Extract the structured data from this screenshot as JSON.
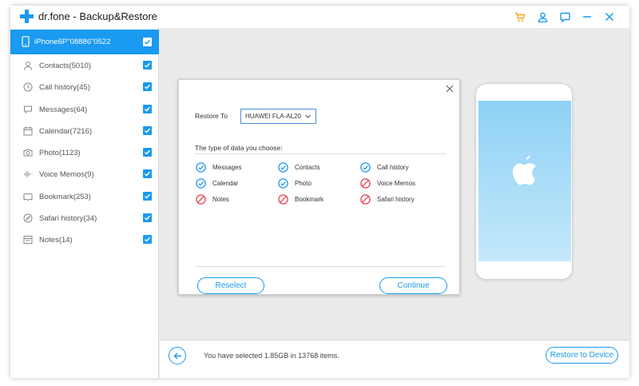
{
  "app": {
    "brand": "dr.fone",
    "title": "- Backup&Restore",
    "window_icons": [
      "cart-icon",
      "account-icon",
      "feedback-icon",
      "minimize-icon",
      "close-icon"
    ]
  },
  "colors": {
    "accent": "#1a9af0",
    "error": "#e8424f",
    "bg": "#ebebeb"
  },
  "sidebar": {
    "device": {
      "name": "iPhone6P\"08886\"0522",
      "checked": true
    },
    "items": [
      {
        "label": "Contacts(5010)",
        "icon": "contacts-icon",
        "checked": true
      },
      {
        "label": "Call history(45)",
        "icon": "clock-icon",
        "checked": true
      },
      {
        "label": "Messages(64)",
        "icon": "chat-icon",
        "checked": true
      },
      {
        "label": "Calendar(7216)",
        "icon": "calendar-icon",
        "checked": true
      },
      {
        "label": "Photo(1123)",
        "icon": "camera-icon",
        "checked": true
      },
      {
        "label": "Voice Memos(9)",
        "icon": "waveform-icon",
        "checked": true
      },
      {
        "label": "Bookmark(253)",
        "icon": "bookmark-icon",
        "checked": true
      },
      {
        "label": "Safari history(34)",
        "icon": "compass-icon",
        "checked": true
      },
      {
        "label": "Notes(14)",
        "icon": "note-icon",
        "checked": true
      }
    ]
  },
  "dialog": {
    "restore_to_label": "Restore To",
    "selected_device": "HUAWEI FLA-AL20",
    "types_title": "The type of data you choose:",
    "types": [
      {
        "label": "Messages",
        "supported": true
      },
      {
        "label": "Contacts",
        "supported": true
      },
      {
        "label": "Call history",
        "supported": true
      },
      {
        "label": "Calendar",
        "supported": true
      },
      {
        "label": "Photo",
        "supported": true
      },
      {
        "label": "Voice Memos",
        "supported": false
      },
      {
        "label": "Notes",
        "supported": false
      },
      {
        "label": "Bookmark",
        "supported": false
      },
      {
        "label": "Safari history",
        "supported": false
      }
    ],
    "reselect_label": "Reselect",
    "continue_label": "Continue"
  },
  "footer": {
    "status_text": "You have selected 1.85GB in 13768 items.",
    "restore_button": "Restore to Device"
  }
}
